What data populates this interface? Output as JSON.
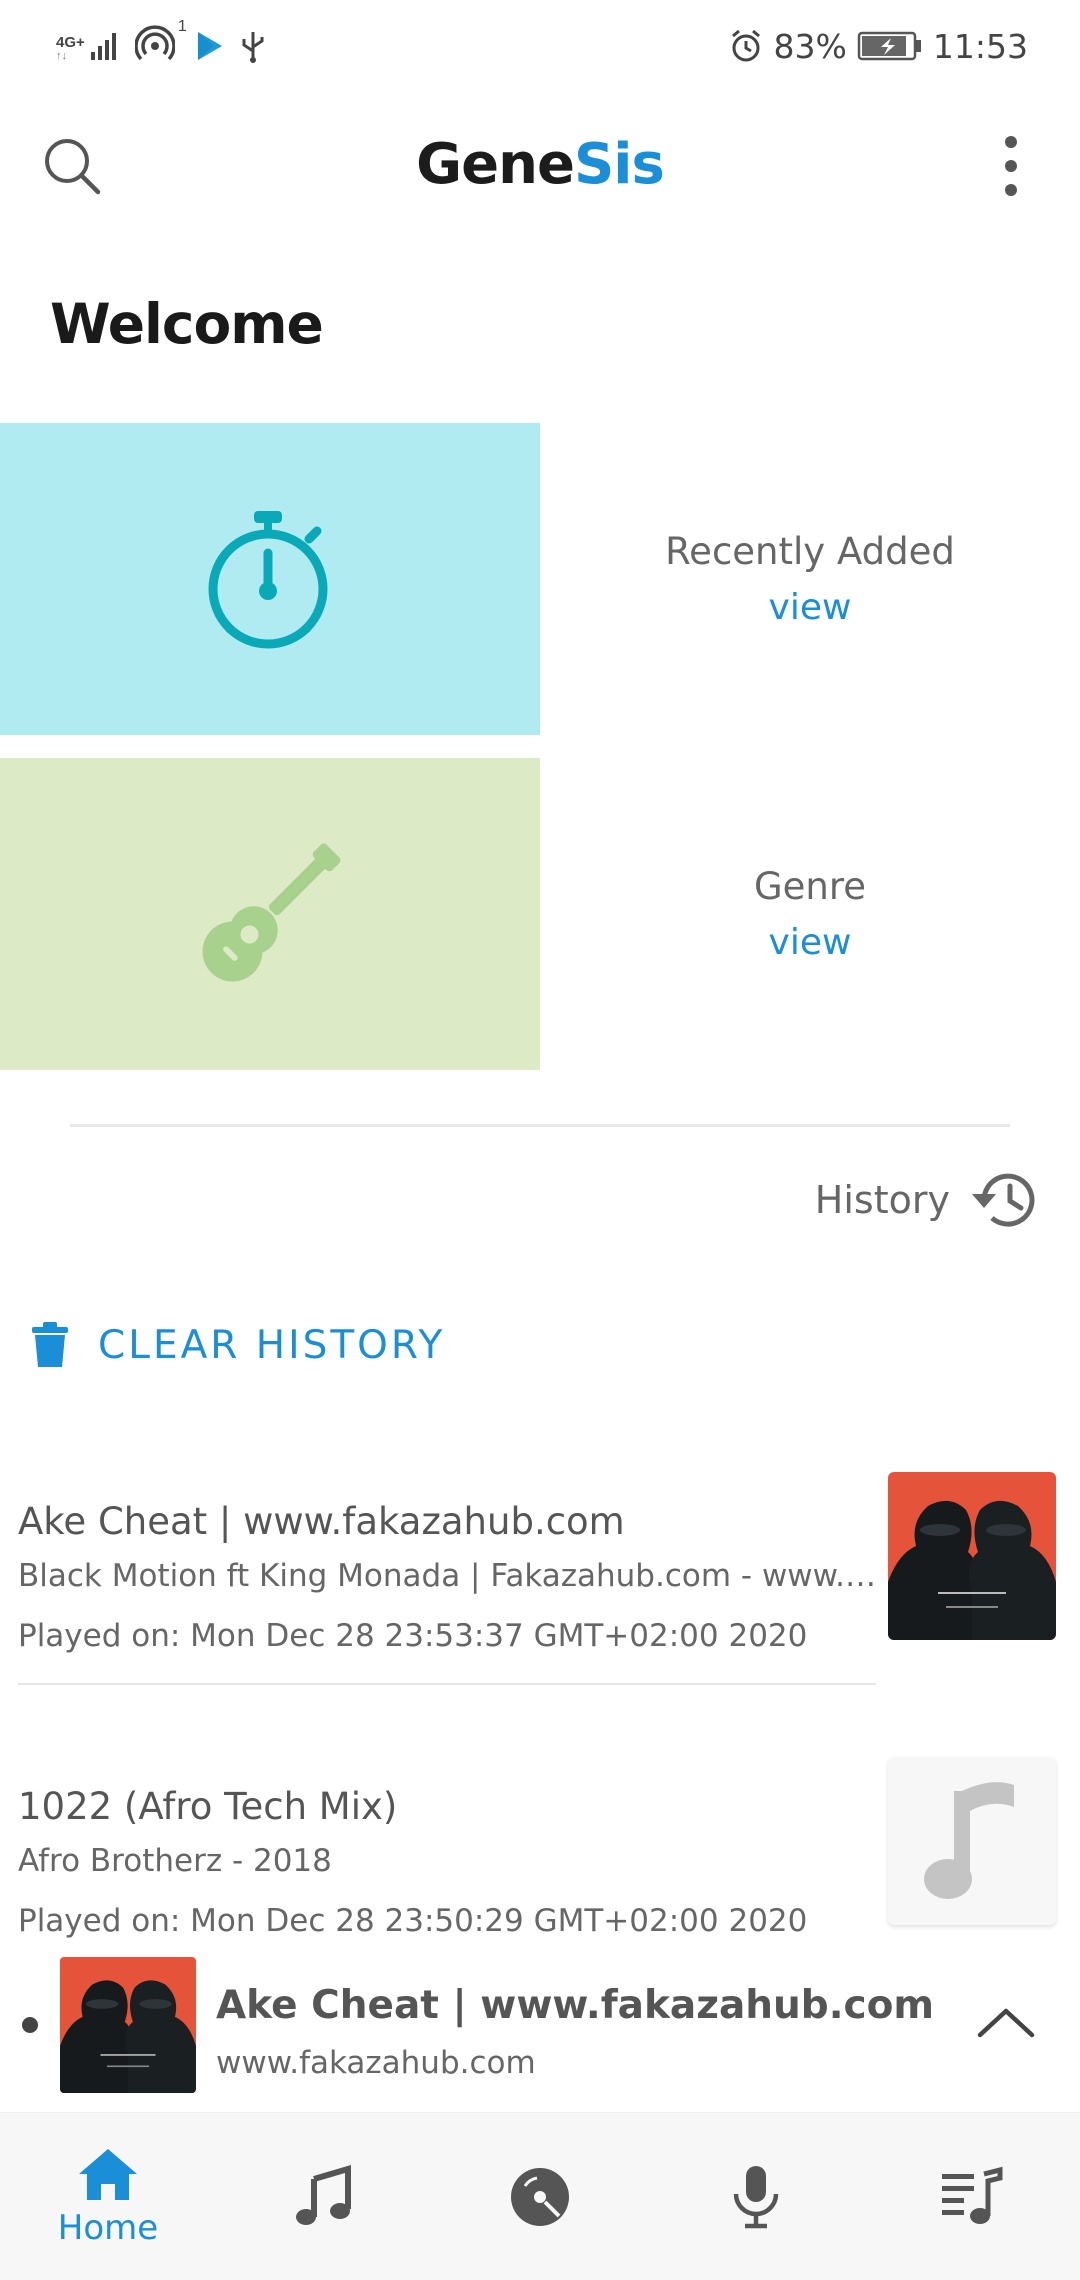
{
  "status_bar": {
    "network": "4G+",
    "network_sub": "1",
    "battery": "83%",
    "time": "11:53"
  },
  "app": {
    "title_part1": "Gene",
    "title_part2": "Sis"
  },
  "welcome": "Welcome",
  "categories": [
    {
      "label": "Recently Added",
      "link": "view",
      "icon": "stopwatch-icon"
    },
    {
      "label": "Genre",
      "link": "view",
      "icon": "guitar-icon"
    }
  ],
  "history": {
    "label": "History",
    "clear_label": "CLEAR HISTORY",
    "items": [
      {
        "title": "Ake Cheat | www.fakazahub.com",
        "subtitle": "Black Motion ft King Monada | Fakazahub.com - www.fakazahub.com",
        "played": "Played on: Mon Dec 28 23:53:37 GMT+02:00 2020",
        "art": "album-art-black-motion"
      },
      {
        "title": "1022 (Afro Tech Mix)",
        "subtitle": "Afro Brotherz - 2018",
        "played": "Played on: Mon Dec 28 23:50:29 GMT+02:00 2020",
        "art": "music-note-icon"
      }
    ]
  },
  "now_playing": {
    "title": "Ake Cheat | www.fakazahub.com",
    "subtitle": "www.fakazahub.com"
  },
  "bottom_nav": {
    "home_label": "Home",
    "items": [
      "home-icon",
      "music-note-icon",
      "album-icon",
      "microphone-icon",
      "playlist-icon"
    ]
  },
  "colors": {
    "accent": "#1a8ed6",
    "recent_tile": "#b1ebf2",
    "recent_icon": "#0aa9b8",
    "genre_tile": "#dcebc6",
    "genre_icon": "#a9d18e"
  }
}
